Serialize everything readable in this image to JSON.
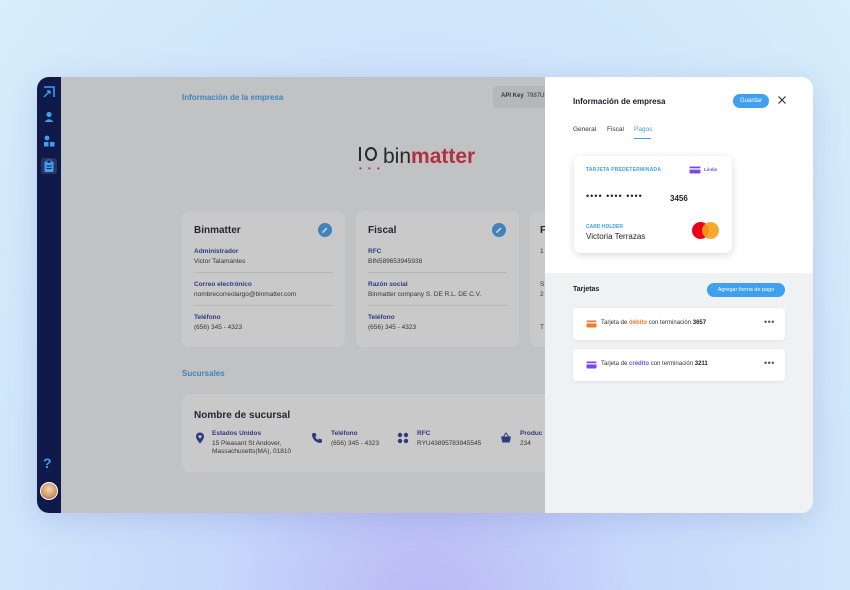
{
  "main": {
    "company_section_title": "Información de la empresa",
    "api_key_label": "API Key",
    "api_key_value": "7987UI",
    "logo": {
      "part1": "bin",
      "part2": "matter",
      "dots": "• • •"
    },
    "cards": [
      {
        "title": "Binmatter",
        "fields": [
          {
            "label": "Administrador",
            "value": "Victor Talamantes"
          },
          {
            "label": "Correo electrónico",
            "value": "nombrecorreolargo@binmatter.com"
          },
          {
            "label": "Teléfono",
            "value": "(656) 345 - 4323"
          }
        ]
      },
      {
        "title": "Fiscal",
        "fields": [
          {
            "label": "RFC",
            "value": "BIN589653945938"
          },
          {
            "label": "Razón social",
            "value": "Binmatter company S. DE R.L. DE C.V."
          },
          {
            "label": "Teléfono",
            "value": "(656) 345 - 4323"
          }
        ]
      }
    ],
    "third_card_partial": {
      "title": "F",
      "l1": "1",
      "l2": "S",
      "l3": "2",
      "l4": "T"
    },
    "branches_title": "Sucursales",
    "branch": {
      "title": "Nombre de sucursal",
      "location_label": "Estados Unidos",
      "location_value_1": "15 Pleasant St Andover,",
      "location_value_2": "Massachusetts(MA), 01810",
      "phone_label": "Teléfono",
      "phone_value": "(656) 345 - 4323",
      "rfc_label": "RFC",
      "rfc_value": "RYU43895783945545",
      "products_label": "Produc",
      "products_value": "234"
    }
  },
  "sidebar": {
    "help_label": "?"
  },
  "panel": {
    "title": "Información de empresa",
    "save_label": "Guardar",
    "tabs": [
      "General",
      "Fiscal",
      "Pagos"
    ],
    "active_tab": "Pagos",
    "card": {
      "default_label": "TARJETA PREDETERMINADA",
      "brand_label": "Lindis",
      "masked": "•••• •••• ••••",
      "last4": "3456",
      "holder_label": "CARD HOLDER",
      "holder_name": "Victoria Terrazas"
    },
    "cards_title": "Tarjetas",
    "add_label": "Agregar forma de pago",
    "rows": [
      {
        "prefix": "Tarjeta de",
        "type": "débito",
        "suffix": "con terminación",
        "last4": "3657"
      },
      {
        "prefix": "Tarjeta de",
        "type": "crédito",
        "suffix": "con terminación",
        "last4": "3211"
      }
    ],
    "more_label": "•••"
  },
  "colors": {
    "accent": "#3ea0ee",
    "sidebar": "#0f1a4a",
    "label_blue": "#2a3a9a",
    "brand_red": "#e02d3c",
    "debit": "#f17b2c",
    "credit": "#7a4be0"
  }
}
